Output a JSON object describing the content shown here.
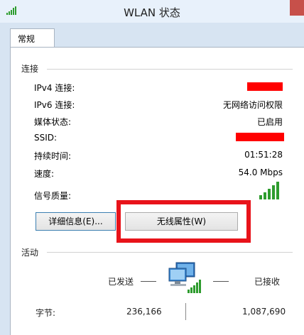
{
  "window": {
    "title": "WLAN 状态"
  },
  "tabs": [
    {
      "label": "常规",
      "selected": true
    }
  ],
  "connection": {
    "header": "连接",
    "rows": [
      {
        "label": "IPv4 连接:",
        "value": "",
        "redacted": true
      },
      {
        "label": "IPv6 连接:",
        "value": "无网络访问权限"
      },
      {
        "label": "媒体状态:",
        "value": "已启用"
      },
      {
        "label": "SSID:",
        "value": "",
        "redacted": true
      },
      {
        "label": "持续时间:",
        "value": "01:51:28"
      },
      {
        "label": "速度:",
        "value": "54.0 Mbps"
      },
      {
        "label": "信号质量:",
        "value": ""
      }
    ],
    "signal_strength": "5/5"
  },
  "buttons": {
    "details": "详细信息(E)...",
    "wireless_properties": "无线属性(W)"
  },
  "activity": {
    "header": "活动",
    "sent_label": "已发送",
    "received_label": "已接收",
    "bytes_label": "字节:",
    "bytes_sent": "236,166",
    "bytes_received": "1,087,690"
  },
  "colors": {
    "highlight": "#e8131a",
    "redaction": "#ff0000",
    "signal": "#2e9c2e"
  }
}
